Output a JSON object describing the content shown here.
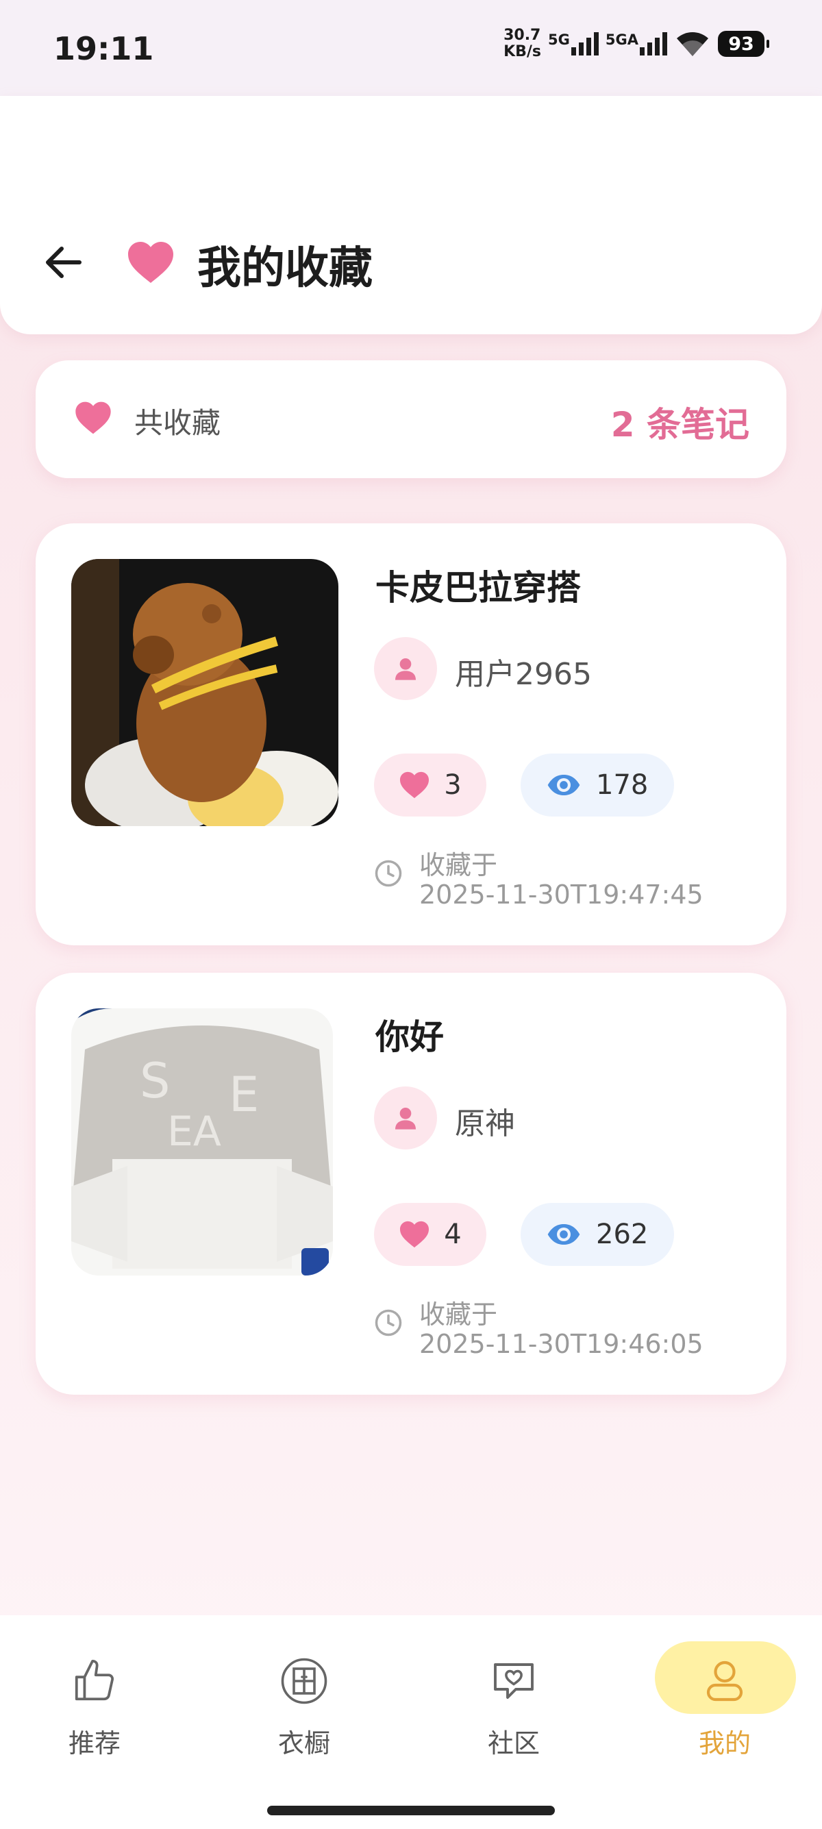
{
  "status_bar": {
    "time": "19:11",
    "net_speed_value": "30.7",
    "net_speed_unit": "KB/s",
    "signal1_label": "5G",
    "signal2_label": "5GA",
    "battery": "93"
  },
  "header": {
    "title": "我的收藏",
    "back_icon": "arrow-left-icon",
    "title_icon": "heart-icon"
  },
  "summary": {
    "label": "共收藏",
    "count_text": "2 条笔记"
  },
  "notes": [
    {
      "title": "卡皮巴拉穿搭",
      "author": "用户2965",
      "likes": "3",
      "views": "178",
      "fav_label": "收藏于",
      "fav_time": "2025-11-30T19:47:45"
    },
    {
      "title": "你好",
      "author": "原神",
      "likes": "4",
      "views": "262",
      "fav_label": "收藏于",
      "fav_time": "2025-11-30T19:46:05"
    }
  ],
  "nav": {
    "items": [
      {
        "label": "推荐",
        "icon": "thumbs-up-icon"
      },
      {
        "label": "衣橱",
        "icon": "wardrobe-icon"
      },
      {
        "label": "社区",
        "icon": "chat-heart-icon"
      },
      {
        "label": "我的",
        "icon": "user-icon"
      }
    ],
    "active_index": 3
  },
  "colors": {
    "accent_pink": "#e26c95",
    "heart_pink": "#ee6f9a",
    "eye_blue": "#4a8fe0",
    "nav_active_bg": "#fff1a4",
    "nav_active_text": "#e3a43a"
  }
}
